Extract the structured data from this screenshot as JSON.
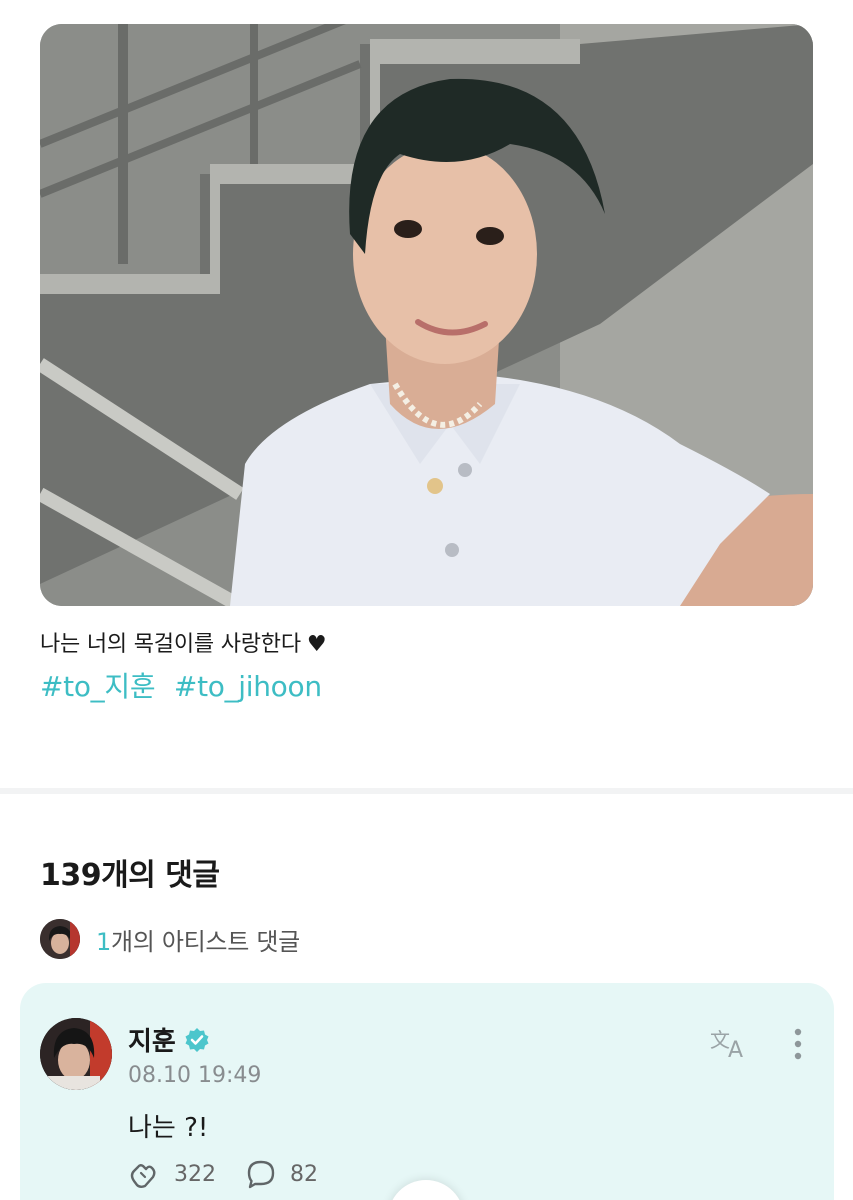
{
  "post": {
    "caption": "나는 너의 목걸이를 사랑한다",
    "caption_heart": "♥",
    "hashtags": [
      "#to_지훈",
      "#to_jihoon"
    ]
  },
  "comments": {
    "title": "139개의 댓글",
    "artist_count": "1",
    "artist_label": "개의 아티스트 댓글",
    "items": [
      {
        "author": "지훈",
        "verified": true,
        "time": "08.10 19:49",
        "text": "나는 ?!",
        "likes": "322",
        "replies": "82"
      }
    ]
  },
  "icons": {
    "verified": "verified-badge-icon",
    "translate": "translate-icon",
    "more": "more-vertical-icon",
    "like": "heart-hands-icon",
    "reply": "speech-bubble-icon"
  },
  "colors": {
    "accent": "#3dbdc4",
    "card_bg": "#e6f7f6",
    "divider": "#f2f3f4"
  }
}
